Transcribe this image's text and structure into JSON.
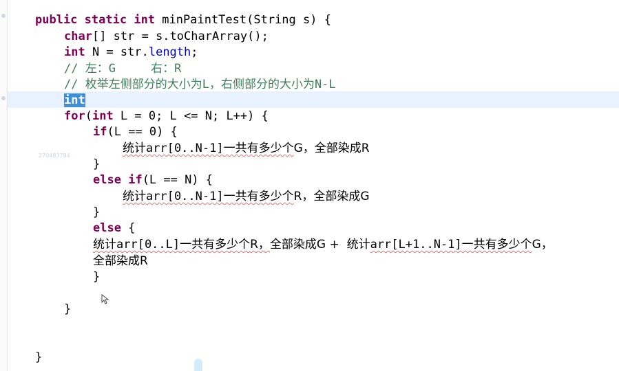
{
  "editor": {
    "faint_watermark": "270483794",
    "lines": {
      "l1": {
        "public": "public",
        "static": "static",
        "int": "int",
        "rest": " minPaintTest(String s) {"
      },
      "l2": {
        "char": "char",
        "rest1": "[] str = s.toCharArray();"
      },
      "l3": {
        "int": "int",
        "rest1": " N = str.",
        "field": "length",
        "rest2": ";"
      },
      "l4": {
        "comment": "// 左：G     右：R"
      },
      "l5": {
        "comment": "// 枚举左侧部分的大小为L，右侧部分的大小为N-L"
      },
      "l6": {
        "selected": "int"
      },
      "l7": {
        "for": "for",
        "int": "int",
        "rest": " L = 0; L <= N; L++) {"
      },
      "l8": {
        "if": "if",
        "rest": "(L == 0) {"
      },
      "l9": {
        "a": "统计",
        "b": "arr[0..N-1]",
        "c": "一共有多少个",
        "d": "G，全部染成R"
      },
      "l10": {
        "text": "}"
      },
      "l11": {
        "else": "else",
        "if": "if",
        "rest": "(L == N) {"
      },
      "l12": {
        "a": "统计",
        "b": "arr[0..N-1]",
        "c": "一共有多少个",
        "d": "R，全部染成G"
      },
      "l13": {
        "text": "}"
      },
      "l14": {
        "else": "else",
        "rest": " {"
      },
      "l15": {
        "a": "统计",
        "b": "arr[0..L]",
        "c": "一共有多少个",
        "d": "R，",
        "e": "全部染成G +  统计",
        "f": "arr[L+1..N-1]",
        "g": "一共有多少个",
        "h": "G，"
      },
      "l16": {
        "text": "全部染成R"
      },
      "l17": {
        "text": "}"
      },
      "l18": {
        "text": "}"
      },
      "l19": {
        "text": "}"
      }
    }
  }
}
